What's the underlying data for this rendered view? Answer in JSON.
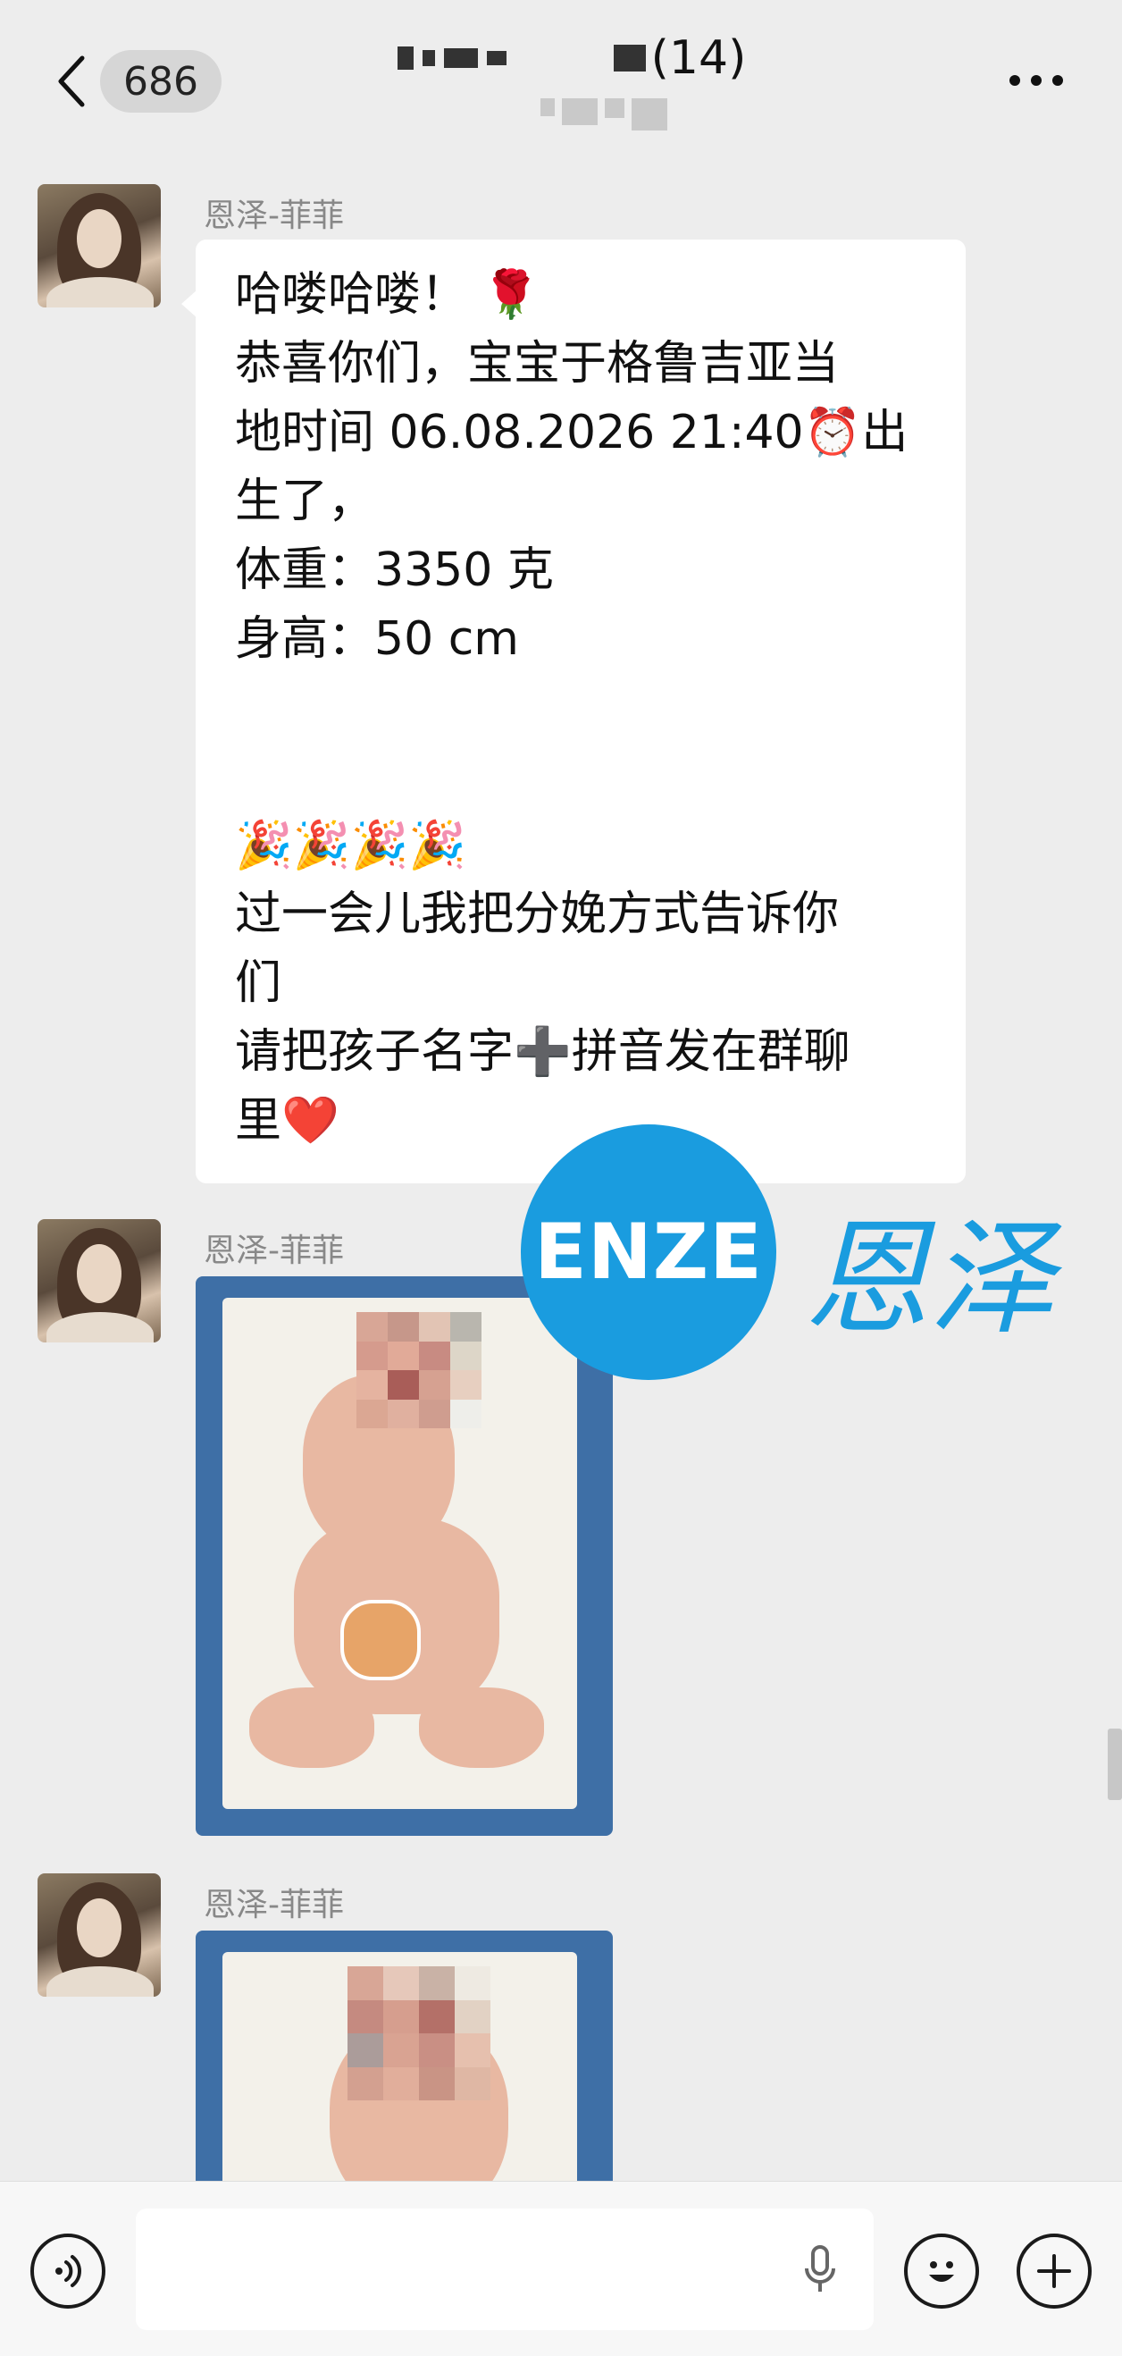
{
  "header": {
    "unread_count": "686",
    "member_count": "(14)"
  },
  "messages": [
    {
      "sender": "恩泽-菲菲",
      "type": "text",
      "lines": [
        "哈喽哈喽！ 🌹",
        "恭喜你们，宝宝于格鲁吉亚当",
        "地时间 06.08.2026 21:40⏰出",
        "生了，",
        "体重：3350 克",
        "身高：50 cm",
        "🎉🎉🎉🎉",
        "过一会儿我把分娩方式告诉你",
        "们",
        "请把孩子名字➕拼音发在群聊",
        "里❤️"
      ]
    },
    {
      "sender": "恩泽-菲菲",
      "type": "image"
    },
    {
      "sender": "恩泽-菲菲",
      "type": "image"
    }
  ],
  "watermark": {
    "logo_text": "ENZE",
    "brand_text": "恩泽",
    "color": "#1a9cdf"
  },
  "input_bar": {
    "placeholder": "",
    "icons": [
      "voice-icon",
      "microphone-icon",
      "emoji-icon",
      "plus-icon"
    ]
  }
}
